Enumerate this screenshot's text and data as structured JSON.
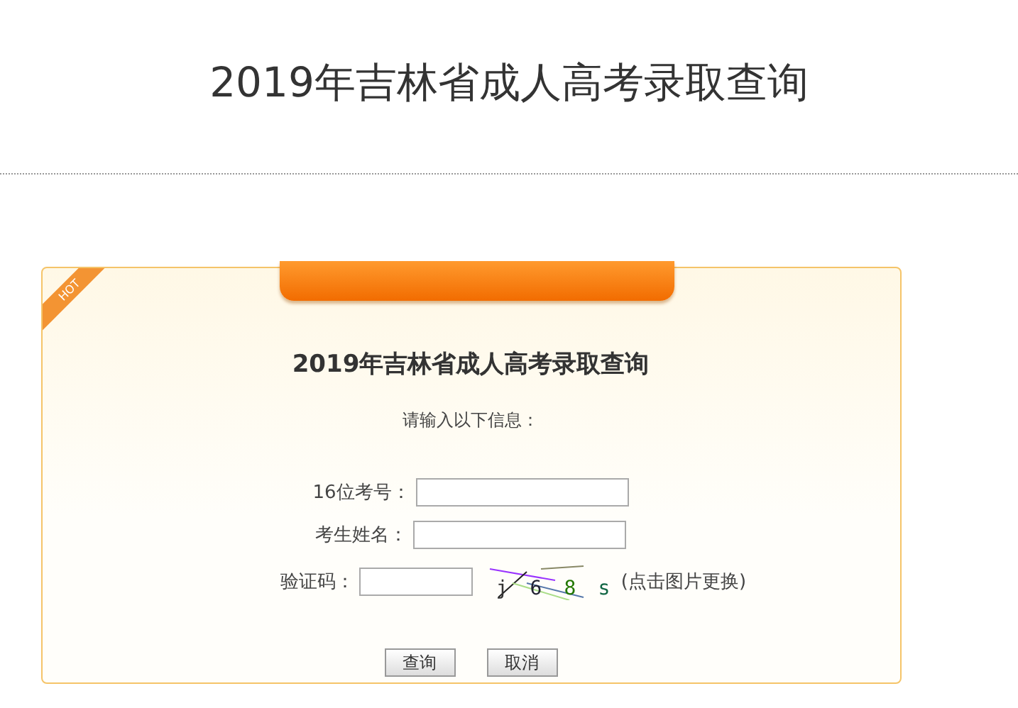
{
  "page_title": "2019年吉林省成人高考录取查询",
  "card": {
    "ribbon": "HOT",
    "heading": "2019年吉林省成人高考录取查询",
    "instruction": "请输入以下信息：",
    "fields": [
      {
        "label": "16位考号：",
        "kind": "text"
      },
      {
        "label": "考生姓名：",
        "kind": "text"
      },
      {
        "label": "验证码：",
        "kind": "captcha"
      }
    ],
    "captcha": {
      "chars": [
        "j",
        "6",
        "8",
        "s"
      ],
      "hint": "(点击图片更换)"
    },
    "buttons": [
      "查询",
      "取消"
    ]
  }
}
